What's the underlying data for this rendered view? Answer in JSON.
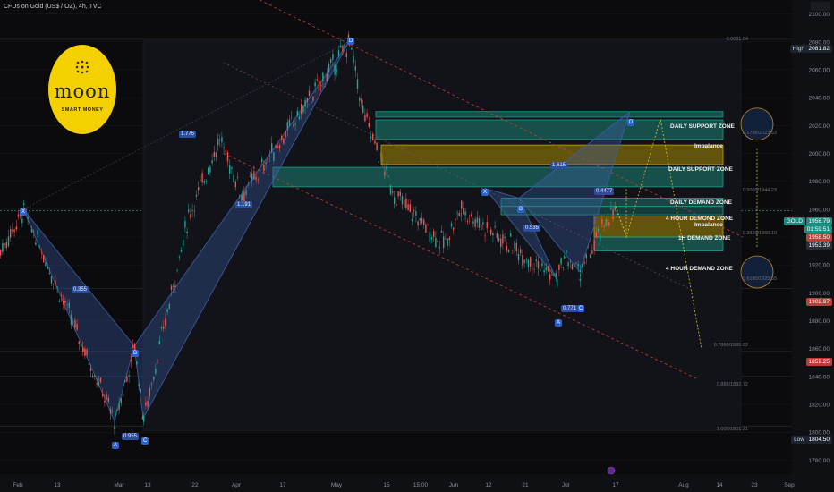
{
  "header": {
    "symbol": "CFDs on Gold (US$ / OZ), 4h, TVC"
  },
  "logo": {
    "word": "moon",
    "sub": "SMART MONEY"
  },
  "colors": {
    "bg": "#0b0b0d",
    "up": "#26a69a",
    "down": "#ef5350",
    "pattern": "#3d5fa8",
    "zone_yellow": "#c8a400",
    "zone_teal": "#1e9c8a",
    "channel": "#d33a3a",
    "projection": "#d4c530"
  },
  "chart_data": {
    "type": "candlestick",
    "title": "CFDs on Gold (US$ / OZ), 4h, TVC",
    "ylim": [
      1770,
      2110
    ],
    "y_ticks": [
      1780,
      1800,
      1820,
      1840,
      1860,
      1880,
      1900,
      1920,
      1940,
      1960,
      1980,
      2000,
      2020,
      2040,
      2060,
      2080,
      2100
    ],
    "x_labels": [
      "Feb",
      "13",
      "Mar",
      "13",
      "22",
      "Apr",
      "17",
      "May",
      "15",
      "15:00",
      "Jun",
      "12",
      "21",
      "Jul",
      "17",
      "Aug",
      "14",
      "23",
      "Sep"
    ],
    "price_path": [
      [
        "start",
        1930
      ],
      [
        "X",
        1960
      ],
      [
        "A",
        1808
      ],
      [
        "B",
        1862
      ],
      [
        "C",
        1810
      ],
      [
        "",
        1955
      ],
      [
        "",
        2010
      ],
      [
        "",
        1970
      ],
      [
        "D",
        2080
      ],
      [
        "",
        2030
      ],
      [
        "",
        1970
      ],
      [
        "",
        1935
      ],
      [
        "",
        1960
      ],
      [
        "A",
        1910
      ],
      [
        "",
        1925
      ],
      [
        "C",
        1915
      ],
      [
        "",
        1955
      ],
      [
        "last",
        1958.79
      ]
    ],
    "harmonic_points": {
      "first": [
        "X",
        "A",
        "B",
        "C",
        "D"
      ],
      "second": [
        "X",
        "A",
        "B",
        "C",
        "D"
      ]
    },
    "ratios": [
      "0.355",
      "0.955",
      "1.775",
      "1.191",
      "0.535",
      "0.771",
      "1.615",
      "0.4477"
    ],
    "zones": [
      {
        "label": "DAILY SUPPORT ZONE",
        "from": 2026,
        "to": 2030
      },
      {
        "label": "Imbalance",
        "from": 2010,
        "to": 2024
      },
      {
        "label": "DAILY SUPPORT ZONE",
        "from": 1992,
        "to": 2006
      },
      {
        "label": "DAILY DEMAND ZONE",
        "from": 1976,
        "to": 1990
      },
      {
        "label": "4 HOUR DEMOND ZONE",
        "from": 1962,
        "to": 1968
      },
      {
        "label": "Imbalance",
        "from": 1956,
        "to": 1962
      },
      {
        "label": "1H DEMAND ZONE",
        "from": 1940,
        "to": 1955
      },
      {
        "label": "4 HOUR DEMAND ZONE",
        "from": 1930,
        "to": 1940
      }
    ],
    "fib_levels": [
      "0.0081.54",
      "0.1786/2023.53",
      "0.3820/1960.10",
      "0.5000/1944.23",
      "0.6180/1925.55",
      "0.7860/1885.92",
      "0.886/1832.72",
      "1.000/1801.21"
    ],
    "price_tags": [
      {
        "label": "High",
        "value": "2081.82"
      },
      {
        "label": "GOLD",
        "value": "1958.79"
      },
      {
        "label": "",
        "value": "01:59:51"
      },
      {
        "label": "",
        "value": "1958.50"
      },
      {
        "label": "",
        "value": "1953.39"
      },
      {
        "label": "",
        "value": "1902.97"
      },
      {
        "label": "",
        "value": "1859.25"
      },
      {
        "label": "Low",
        "value": "1804.50"
      }
    ]
  }
}
